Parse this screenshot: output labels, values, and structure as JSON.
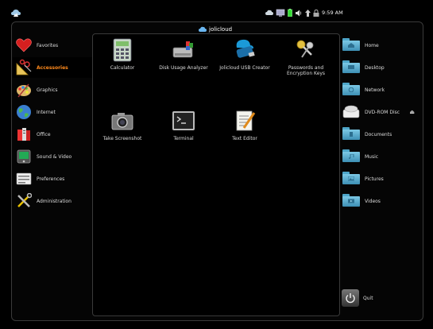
{
  "topbar": {
    "clock": "9:59 AM",
    "tray_icons": [
      "cloud-icon",
      "network-monitor-icon",
      "battery-icon",
      "volume-icon",
      "upload-icon",
      "lock-icon"
    ]
  },
  "brand": {
    "name": "jolicloud"
  },
  "categories": [
    {
      "label": "Favorites",
      "icon": "heart-icon"
    },
    {
      "label": "Accessories",
      "icon": "accessories-icon",
      "active": true
    },
    {
      "label": "Graphics",
      "icon": "graphics-icon"
    },
    {
      "label": "Internet",
      "icon": "globe-icon"
    },
    {
      "label": "Office",
      "icon": "office-icon"
    },
    {
      "label": "Sound & Video",
      "icon": "sound-video-icon"
    },
    {
      "label": "Preferences",
      "icon": "preferences-icon"
    },
    {
      "label": "Administration",
      "icon": "administration-icon"
    }
  ],
  "apps": [
    {
      "label": "Calculator",
      "icon": "calculator-icon"
    },
    {
      "label": "Disk Usage Analyzer",
      "icon": "disk-usage-icon"
    },
    {
      "label": "Jolicloud USB Creator",
      "icon": "usb-creator-icon"
    },
    {
      "label": "Passwords and Encryption Keys",
      "icon": "keys-icon"
    },
    {
      "label": "Take Screenshot",
      "icon": "camera-icon"
    },
    {
      "label": "Terminal",
      "icon": "terminal-icon"
    },
    {
      "label": "Text Editor",
      "icon": "text-editor-icon"
    }
  ],
  "places": [
    {
      "label": "Home",
      "icon": "home-folder-icon"
    },
    {
      "label": "Desktop",
      "icon": "desktop-folder-icon"
    },
    {
      "label": "Network",
      "icon": "network-folder-icon"
    },
    {
      "label": "DVD-ROM Disc",
      "icon": "dvd-drive-icon",
      "eject": "⏏"
    },
    {
      "label": "Documents",
      "icon": "documents-folder-icon"
    },
    {
      "label": "Music",
      "icon": "music-folder-icon"
    },
    {
      "label": "Pictures",
      "icon": "pictures-folder-icon"
    },
    {
      "label": "Videos",
      "icon": "videos-folder-icon"
    }
  ],
  "quit": {
    "label": "Quit"
  },
  "colors": {
    "active_category": "#ff8a1c",
    "folder": "#5fb3d6",
    "background": "#000000"
  }
}
